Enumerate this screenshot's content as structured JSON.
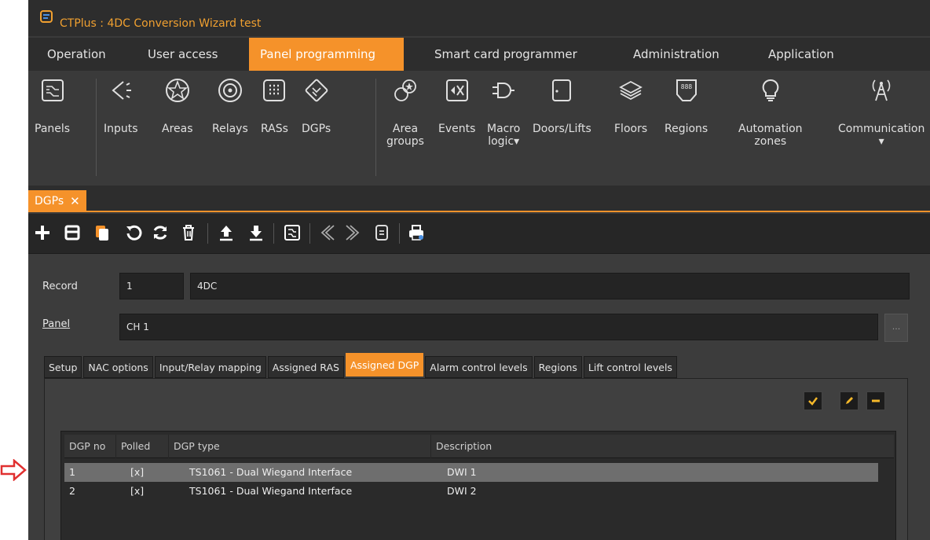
{
  "window": {
    "title": "CTPlus : 4DC Conversion Wizard test"
  },
  "menu": {
    "items": [
      {
        "label": "Operation"
      },
      {
        "label": "User access"
      },
      {
        "label": "Panel programming",
        "active": true
      },
      {
        "label": "Smart card programmer"
      },
      {
        "label": "Administration"
      },
      {
        "label": "Application"
      }
    ]
  },
  "ribbon": {
    "items": [
      {
        "line1": "Panels",
        "line2": "",
        "icon": "panels-icon"
      },
      {
        "line1": "Inputs",
        "line2": "",
        "icon": "inputs-icon"
      },
      {
        "line1": "Areas",
        "line2": "",
        "icon": "areas-icon"
      },
      {
        "line1": "Relays",
        "line2": "",
        "icon": "relays-icon"
      },
      {
        "line1": "RASs",
        "line2": "",
        "icon": "ras-keypad-icon"
      },
      {
        "line1": "DGPs",
        "line2": "",
        "icon": "dgp-icon"
      },
      {
        "line1": "Area",
        "line2": "groups",
        "icon": "area-groups-icon"
      },
      {
        "line1": "Events",
        "line2": "",
        "icon": "events-icon"
      },
      {
        "line1": "Macro",
        "line2": "logic▾",
        "icon": "macro-logic-icon"
      },
      {
        "line1": "Doors/Lifts",
        "line2": "",
        "icon": "door-icon"
      },
      {
        "line1": "Floors",
        "line2": "",
        "icon": "floors-icon"
      },
      {
        "line1": "Regions",
        "line2": "",
        "icon": "regions-icon"
      },
      {
        "line1": "Automation",
        "line2": "zones",
        "icon": "bulb-icon"
      },
      {
        "line1": "Communication",
        "line2": "▾",
        "icon": "communication-icon"
      }
    ]
  },
  "doc_tab": {
    "label": "DGPs",
    "close": "✕"
  },
  "toolbar": {
    "icons": [
      "add-icon",
      "save-icon",
      "copy-icon",
      "undo-icon",
      "refresh-icon",
      "delete-icon",
      "upload-icon",
      "download-icon",
      "map-icon",
      "previous-icon",
      "next-icon",
      "notes-icon",
      "print-icon"
    ]
  },
  "record": {
    "label": "Record",
    "number": "1",
    "name": "4DC"
  },
  "panel": {
    "label": "Panel",
    "value": "CH 1",
    "ellipsis": "..."
  },
  "tabs": [
    {
      "label": "Setup"
    },
    {
      "label": "NAC options"
    },
    {
      "label": "Input/Relay mapping"
    },
    {
      "label": "Assigned RAS"
    },
    {
      "label": "Assigned DGP",
      "active": true
    },
    {
      "label": "Alarm control levels"
    },
    {
      "label": "Regions"
    },
    {
      "label": "Lift control levels"
    }
  ],
  "grid_actions": [
    "check-icon",
    "edit-pencil-icon",
    "remove-icon"
  ],
  "table": {
    "columns": [
      "DGP no",
      "Polled",
      "DGP type",
      "Description"
    ],
    "rows": [
      {
        "dgp_no": "1",
        "polled": "[x]",
        "type": "TS1061 - Dual Wiegand Interface",
        "description": "DWI 1",
        "selected": true
      },
      {
        "dgp_no": "2",
        "polled": "[x]",
        "type": "TS1061 - Dual Wiegand Interface",
        "description": "DWI 2",
        "selected": false
      }
    ]
  },
  "colors": {
    "accent": "#f5922a",
    "title_text": "#f0a030",
    "pointer": "#e03030",
    "background": "#3a3a3a"
  }
}
